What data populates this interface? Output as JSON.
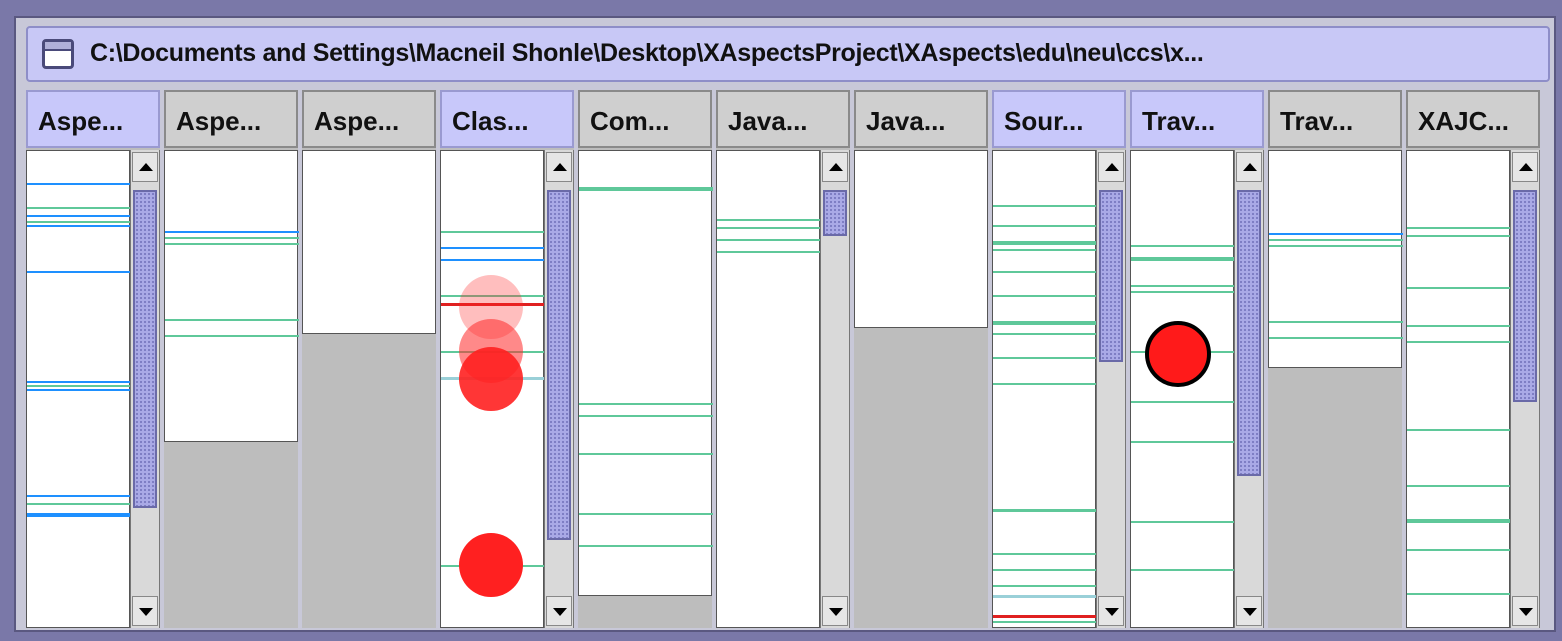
{
  "window": {
    "title": "C:\\Documents and Settings\\Macneil Shonle\\Desktop\\XAspectsProject\\XAspects\\edu\\neu\\ccs\\x...",
    "icon": "window-icon"
  },
  "colors": {
    "blue_line": "#1e90ff",
    "green_line": "#5fc89a",
    "red_line": "#e02020",
    "marker_red": "#ff2020",
    "header_active": "#c8c8fa",
    "header_inactive": "#cfcfcf"
  },
  "columns": [
    {
      "label": "Aspe...",
      "active": true
    },
    {
      "label": "Aspe...",
      "active": false
    },
    {
      "label": "Aspe...",
      "active": false
    },
    {
      "label": "Clas...",
      "active": true
    },
    {
      "label": "Com...",
      "active": false
    },
    {
      "label": "Java...",
      "active": false
    },
    {
      "label": "Java...",
      "active": false
    },
    {
      "label": "Sour...",
      "active": true
    },
    {
      "label": "Trav...",
      "active": true
    },
    {
      "label": "Trav...",
      "active": false
    },
    {
      "label": "XAJC...",
      "active": false
    }
  ]
}
